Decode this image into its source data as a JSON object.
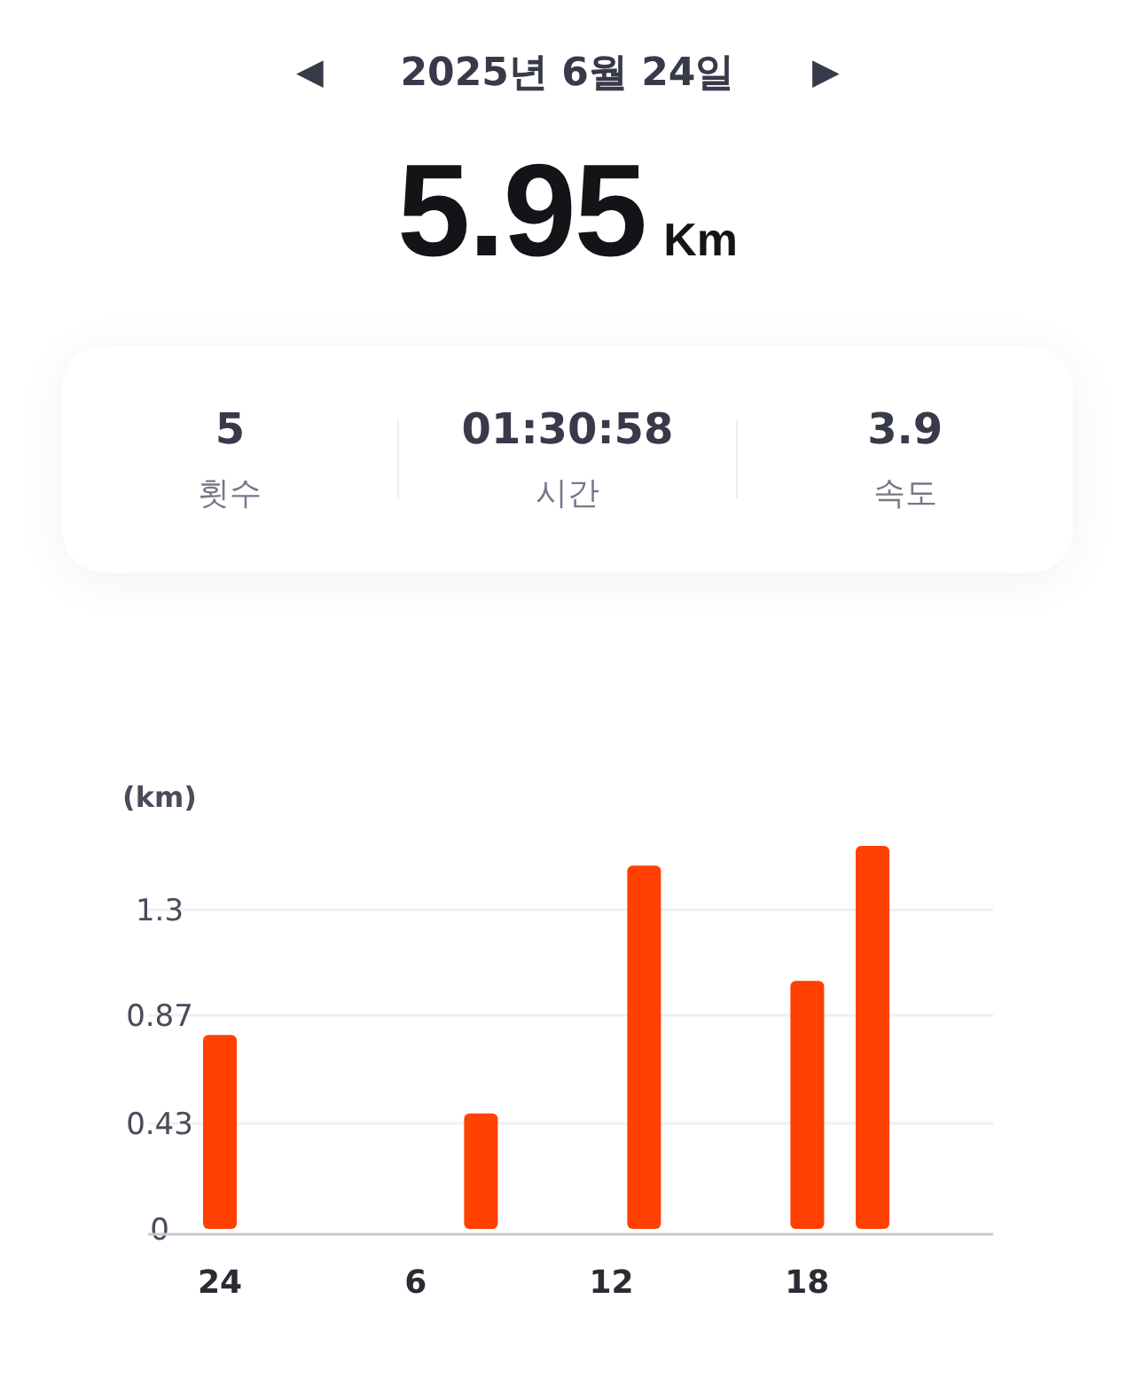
{
  "header": {
    "date": "2025년 6월 24일",
    "prev": "◀",
    "next": "▶"
  },
  "total": {
    "value": "5.95",
    "unit": "Km"
  },
  "stats": [
    {
      "value": "5",
      "label": "횟수"
    },
    {
      "value": "01:30:58",
      "label": "시간"
    },
    {
      "value": "3.9",
      "label": "속도"
    }
  ],
  "chart": {
    "midnight_label": "24",
    "chart_data": {
      "type": "bar",
      "ylabel": "(km)",
      "x": [
        0,
        8,
        13,
        18,
        20
      ],
      "series": [
        {
          "color": "#ff4000",
          "values": [
            0.79,
            0.47,
            1.48,
            1.01,
            1.56
          ]
        }
      ],
      "xlim": [
        -2.2,
        23.7
      ],
      "ylim": [
        0,
        1.56
      ],
      "xticks": [
        6,
        12,
        18
      ],
      "grid": true,
      "yticks": [
        0,
        0.43,
        0.87,
        1.3
      ]
    }
  }
}
